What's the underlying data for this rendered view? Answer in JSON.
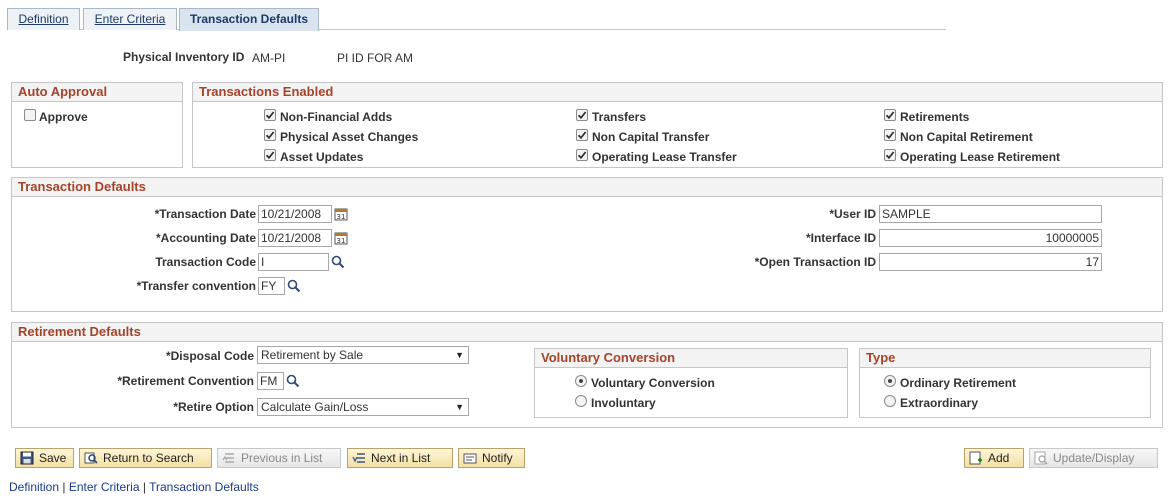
{
  "tabs": [
    {
      "label": "Definition",
      "active": false
    },
    {
      "label": "Enter Criteria",
      "active": false
    },
    {
      "label": "Transaction Defaults",
      "active": true
    }
  ],
  "header": {
    "pi_label": "Physical Inventory ID",
    "pi_value": "AM-PI",
    "pi_desc": "PI ID FOR AM"
  },
  "auto_approval": {
    "title": "Auto Approval",
    "approve_label": "Approve",
    "approve_checked": false
  },
  "transactions_enabled": {
    "title": "Transactions Enabled",
    "items": [
      {
        "label": "Non-Financial Adds",
        "checked": true
      },
      {
        "label": "Physical Asset Changes",
        "checked": true
      },
      {
        "label": "Asset Updates",
        "checked": true
      },
      {
        "label": "Transfers",
        "checked": true
      },
      {
        "label": "Non Capital Transfer",
        "checked": true
      },
      {
        "label": "Operating Lease Transfer",
        "checked": true
      },
      {
        "label": "Retirements",
        "checked": true
      },
      {
        "label": "Non Capital Retirement",
        "checked": true
      },
      {
        "label": "Operating Lease Retirement",
        "checked": true
      }
    ]
  },
  "transaction_defaults": {
    "title": "Transaction Defaults",
    "transaction_date_label": "*Transaction Date",
    "transaction_date": "10/21/2008",
    "accounting_date_label": "*Accounting Date",
    "accounting_date": "10/21/2008",
    "transaction_code_label": "Transaction Code",
    "transaction_code": "I",
    "transfer_convention_label": "*Transfer convention",
    "transfer_convention": "FY",
    "user_id_label": "*User ID",
    "user_id": "SAMPLE",
    "interface_id_label": "*Interface ID",
    "interface_id": "10000005",
    "open_transaction_id_label": "*Open Transaction ID",
    "open_transaction_id": "17"
  },
  "retirement_defaults": {
    "title": "Retirement Defaults",
    "disposal_code_label": "*Disposal Code",
    "disposal_code": "Retirement by Sale",
    "retirement_convention_label": "*Retirement Convention",
    "retirement_convention": "FM",
    "retire_option_label": "*Retire Option",
    "retire_option": "Calculate Gain/Loss"
  },
  "voluntary_conversion": {
    "title": "Voluntary Conversion",
    "options": [
      {
        "label": "Voluntary Conversion",
        "selected": true
      },
      {
        "label": "Involuntary",
        "selected": false
      }
    ]
  },
  "type_group": {
    "title": "Type",
    "options": [
      {
        "label": "Ordinary Retirement",
        "selected": true
      },
      {
        "label": "Extraordinary",
        "selected": false
      }
    ]
  },
  "toolbar": {
    "save": "Save",
    "return_to_search": "Return to Search",
    "previous_in_list": "Previous in List",
    "next_in_list": "Next in List",
    "notify": "Notify",
    "add": "Add",
    "update_display": "Update/Display"
  },
  "footer_links": {
    "definition": "Definition",
    "enter_criteria": "Enter Criteria",
    "transaction_defaults": "Transaction Defaults",
    "separator": " | "
  }
}
